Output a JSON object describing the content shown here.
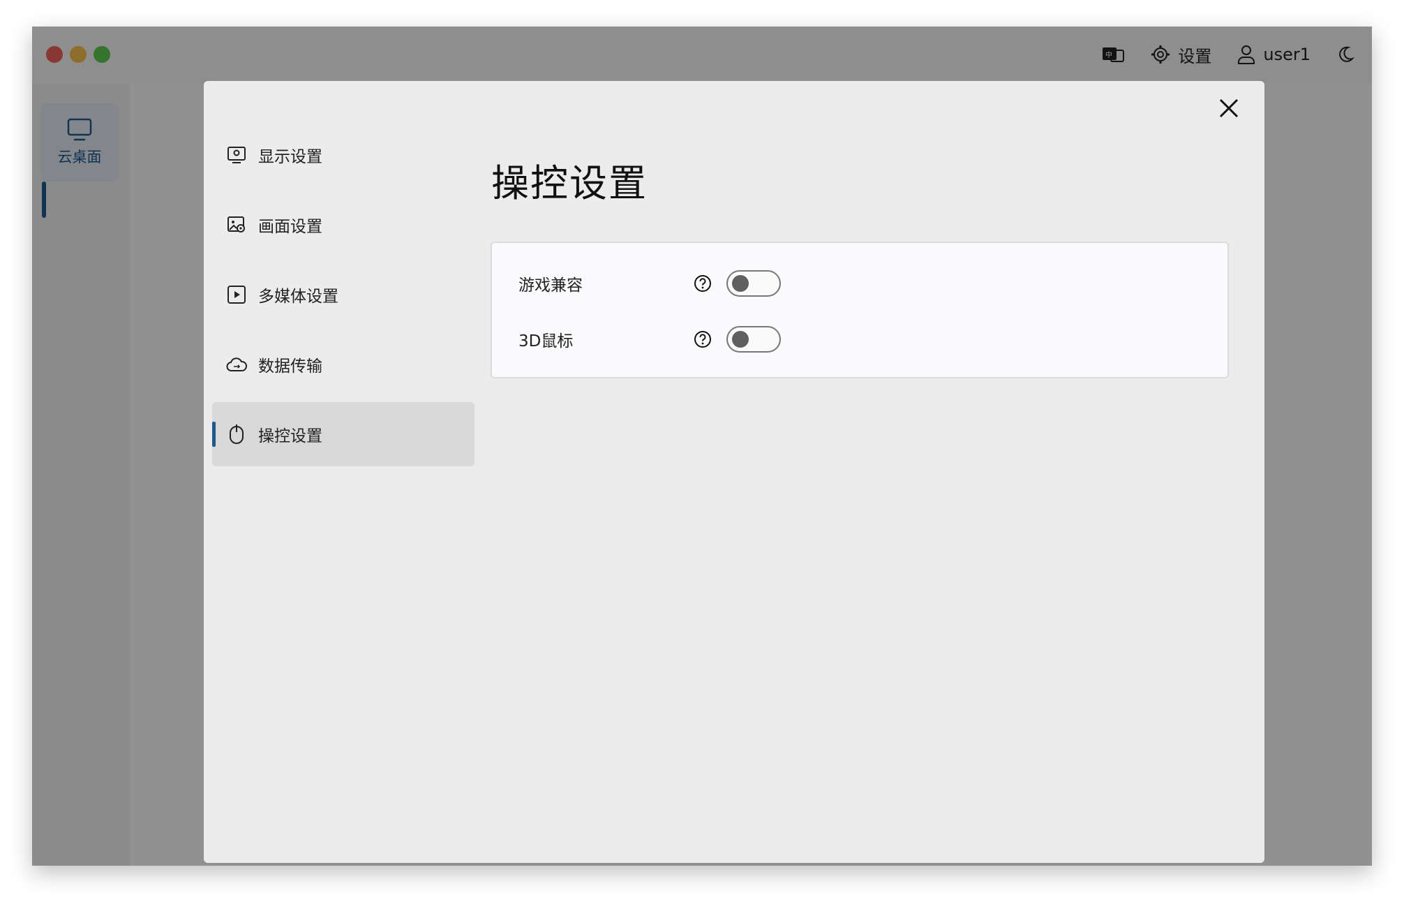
{
  "colors": {
    "accent": "#1e5a8e",
    "close_red": "#ec5f57",
    "minimize_yellow": "#f5be4f",
    "zoom_green": "#5ac84f",
    "toggle_knob_off": "#606060"
  },
  "titlebar": {
    "settings_label": "设置",
    "username": "user1"
  },
  "rail": {
    "items": [
      {
        "label": "云桌面",
        "icon": "monitor-icon",
        "active": true
      }
    ]
  },
  "modal": {
    "nav": [
      {
        "label": "显示设置",
        "icon": "display-icon",
        "active": false
      },
      {
        "label": "画面设置",
        "icon": "picture-icon",
        "active": false
      },
      {
        "label": "多媒体设置",
        "icon": "play-icon",
        "active": false
      },
      {
        "label": "数据传输",
        "icon": "cloud-transfer-icon",
        "active": false
      },
      {
        "label": "操控设置",
        "icon": "mouse-icon",
        "active": true
      }
    ],
    "title": "操控设置",
    "settings": [
      {
        "label": "游戏兼容",
        "enabled": false
      },
      {
        "label": "3D鼠标",
        "enabled": false
      }
    ]
  }
}
